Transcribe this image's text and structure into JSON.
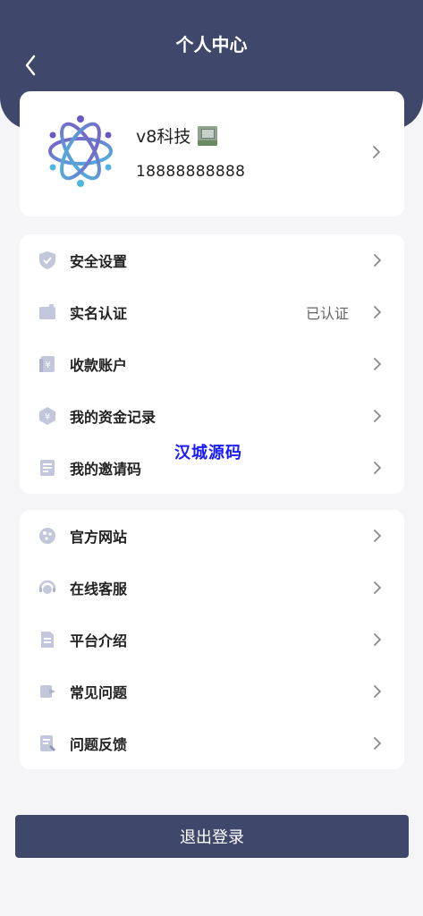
{
  "header": {
    "title": "个人中心",
    "back_icon": "chevron-left-icon",
    "background_color": "#3f476a"
  },
  "profile": {
    "username": "v8科技",
    "phone": "18888888888",
    "logo_icon": "atom-logo-icon",
    "badge_icon": "vip-badge-icon"
  },
  "menu_group_1": [
    {
      "label": "安全设置",
      "value": "",
      "icon": "shield-icon"
    },
    {
      "label": "实名认证",
      "value": "已认证",
      "icon": "id-card-icon"
    },
    {
      "label": "收款账户",
      "value": "",
      "icon": "account-icon"
    },
    {
      "label": "我的资金记录",
      "value": "",
      "icon": "fund-record-icon"
    },
    {
      "label": "我的邀请码",
      "value": "",
      "icon": "invite-code-icon"
    }
  ],
  "menu_group_2": [
    {
      "label": "官方网站",
      "value": "",
      "icon": "website-icon"
    },
    {
      "label": "在线客服",
      "value": "",
      "icon": "customer-service-icon"
    },
    {
      "label": "平台介绍",
      "value": "",
      "icon": "document-icon"
    },
    {
      "label": "常见问题",
      "value": "",
      "icon": "faq-icon"
    },
    {
      "label": "问题反馈",
      "value": "",
      "icon": "feedback-icon"
    }
  ],
  "watermark": "汉城源码",
  "logout": {
    "label": "退出登录"
  },
  "colors": {
    "accent": "#3f476a",
    "icon": "#c3c7dc",
    "background": "#f5f5f7"
  }
}
